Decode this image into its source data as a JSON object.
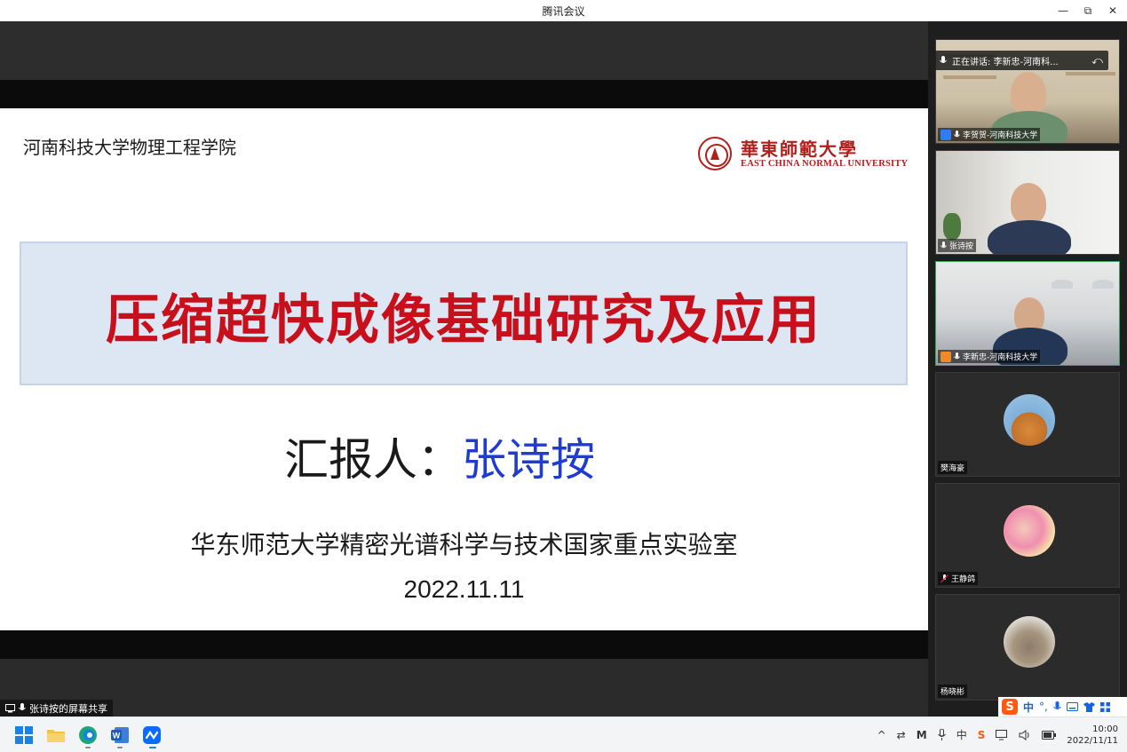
{
  "window": {
    "title": "腾讯会议",
    "controls": [
      "—",
      "⧉",
      "✕"
    ]
  },
  "slide": {
    "college": "河南科技大学物理工程学院",
    "logo_cn": "華東師範大學",
    "logo_en": "EAST CHINA NORMAL UNIVERSITY",
    "main_title": "压缩超快成像基础研究及应用",
    "reporter_label": "汇报人：",
    "reporter_name": "张诗按",
    "lab": "华东师范大学精密光谱科学与技术国家重点实验室",
    "date": "2022.11.11"
  },
  "share_bar": {
    "text": "张诗按的屏幕共享"
  },
  "speaking": {
    "text": "正在讲话: 李新忠-河南科..."
  },
  "participants": [
    {
      "name": "李贺贺-河南科技大学",
      "badge_color": "#2f7df6"
    },
    {
      "name": "张诗按",
      "badge_color": ""
    },
    {
      "name": "李新忠-河南科技大学",
      "badge_color": "#f08a24"
    },
    {
      "name": "樊海豪",
      "badge_color": ""
    },
    {
      "name": "王静鸽",
      "badge_color": ""
    },
    {
      "name": "杨晓彬",
      "badge_color": ""
    }
  ],
  "ime": {
    "mode": "中",
    "punct": "°,"
  },
  "taskbar": {
    "apps": [
      "windows-start",
      "file-explorer",
      "edge",
      "word",
      "tencent-meeting"
    ]
  },
  "tray": {
    "time": "10:00",
    "date": "2022/11/11"
  }
}
